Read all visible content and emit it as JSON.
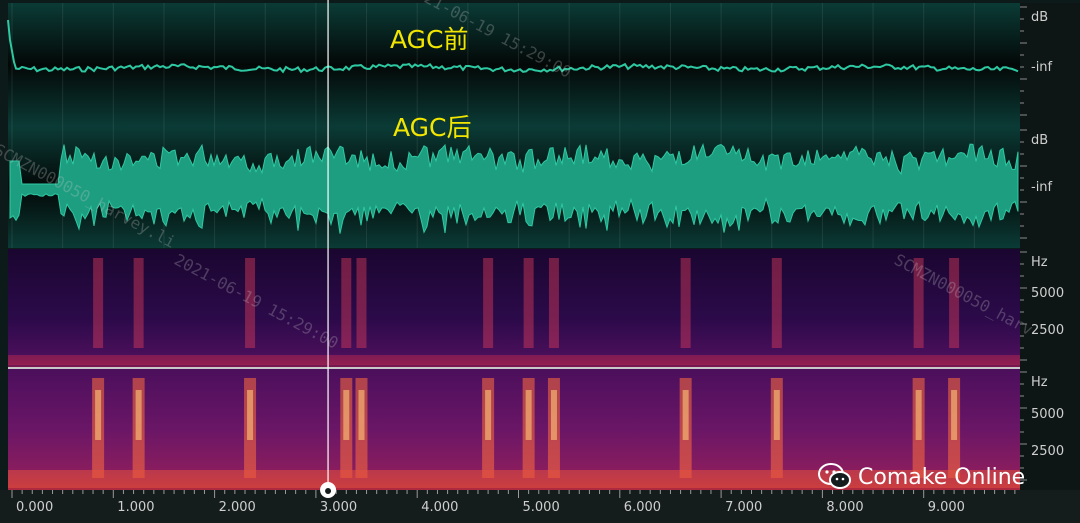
{
  "annotations": {
    "before_agc": "AGC前",
    "after_agc": "AGC后"
  },
  "lanes": {
    "waveform_top": {
      "unit": "dB",
      "floor": "-inf"
    },
    "waveform_bottom": {
      "unit": "dB",
      "floor": "-inf"
    },
    "spectrogram_top": {
      "unit": "Hz",
      "ticks": [
        "5000",
        "2500"
      ]
    },
    "spectrogram_bottom": {
      "unit": "Hz",
      "ticks": [
        "5000",
        "2500"
      ]
    }
  },
  "timeline": {
    "ticks": [
      "0.000",
      "1.000",
      "2.000",
      "3.000",
      "4.000",
      "5.000",
      "6.000",
      "7.000",
      "8.000",
      "9.000"
    ],
    "playhead_seconds": 3.12
  },
  "watermarks": [
    "21-06-19 15:29:00",
    "SCMZN000050_harvey.li",
    "2021-06-19 15:29:00",
    "SCMZN000050_harv"
  ],
  "credit": {
    "icon": "wechat-icon",
    "text": "Comake Online"
  },
  "colors": {
    "waveform": "#2ec9a3",
    "annotation": "#f2e600",
    "background": "#0d1a1a"
  }
}
